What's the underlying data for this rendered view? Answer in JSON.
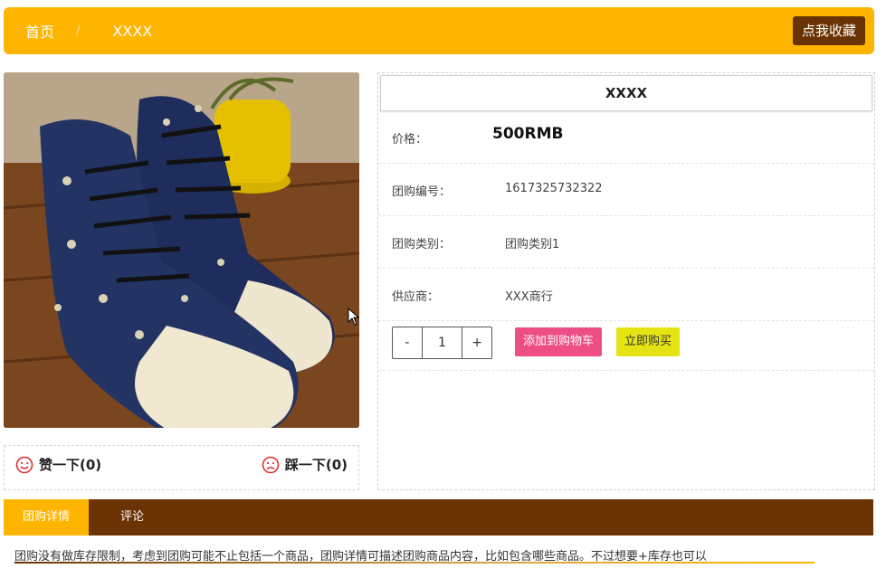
{
  "header": {
    "breadcrumb_home": "首页",
    "breadcrumb_sep": "/",
    "breadcrumb_current": "XXXX",
    "favorite_button": "点我收藏",
    "bg_color": "#fdb500",
    "button_color": "#6a3303"
  },
  "product": {
    "image_icon": "product-photo-sneakers",
    "title": "XXXX",
    "price_label": "价格：",
    "price_value": "500RMB",
    "group_id_label": "团购编号：",
    "group_id_value": "1617325732322",
    "category_label": "团购类别：",
    "category_value": "团购类别1",
    "supplier_label": "供应商：",
    "supplier_value": "XXX商行"
  },
  "quantity": {
    "minus": "-",
    "value": "1",
    "plus": "+"
  },
  "actions": {
    "add_to_cart": "添加到购物车",
    "buy_now": "立即购买",
    "add_to_cart_color": "#ee4e86",
    "buy_now_color": "#e4e414"
  },
  "votes": {
    "like": "赞一下(0)",
    "dislike": "踩一下(0)",
    "icon_color": "#e0322c"
  },
  "tabs": [
    {
      "label": "团购详情",
      "active": true
    },
    {
      "label": "评论",
      "active": false
    }
  ],
  "detail": {
    "text": "团购没有做库存限制，考虑到团购可能不止包括一个商品，团购详情可描述团购商品内容，比如包含哪些商品。不过想要+库存也可以"
  }
}
